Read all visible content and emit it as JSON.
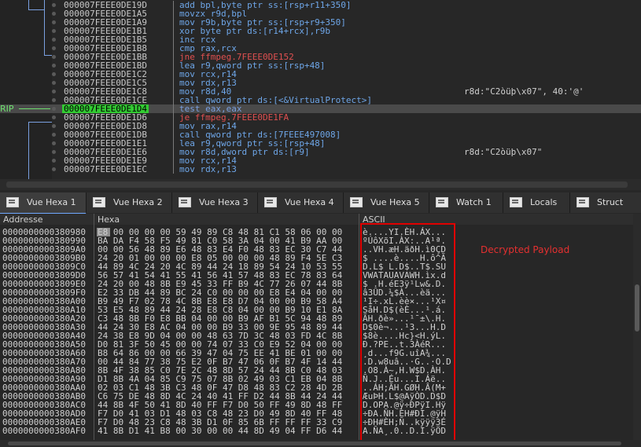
{
  "disasm": {
    "rip_label": "RIP",
    "rows": [
      {
        "addr": "000007FEEE0DE19D",
        "instr": "add bpl,byte ptr ss:[rsp+r11+350]",
        "comment": ""
      },
      {
        "addr": "000007FEEE0DE1A5",
        "instr": "movzx r9d,bpl",
        "comment": ""
      },
      {
        "addr": "000007FEEE0DE1A9",
        "instr": "mov r9b,byte ptr ss:[rsp+r9+350]",
        "comment": ""
      },
      {
        "addr": "000007FEEE0DE1B1",
        "instr": "xor byte ptr ds:[r14+rcx],r9b",
        "comment": ""
      },
      {
        "addr": "000007FEEE0DE1B5",
        "instr": "inc rcx",
        "comment": ""
      },
      {
        "addr": "000007FEEE0DE1B8",
        "instr": "cmp rax,rcx",
        "comment": ""
      },
      {
        "addr": "000007FEEE0DE1BB",
        "instr": "jne ffmpeg.7FEEE0DE152",
        "comment": ""
      },
      {
        "addr": "000007FEEE0DE1BD",
        "instr": "lea r9,qword ptr ss:[rsp+48]",
        "comment": ""
      },
      {
        "addr": "000007FEEE0DE1C2",
        "instr": "mov rcx,r14",
        "comment": ""
      },
      {
        "addr": "000007FEEE0DE1C5",
        "instr": "mov rdx,r13",
        "comment": ""
      },
      {
        "addr": "000007FEEE0DE1C8",
        "instr": "mov r8d,40",
        "comment": "r8d:\"C2òüþ\\x07\", 40:'@'"
      },
      {
        "addr": "000007FEEE0DE1CE",
        "instr": "call qword ptr ds:[<&VirtualProtect>]",
        "comment": ""
      },
      {
        "addr": "000007FEEE0DE1D4",
        "instr": "test eax,eax",
        "comment": ""
      },
      {
        "addr": "000007FEEE0DE1D6",
        "instr": "je ffmpeg.7FEEE0DE1FA",
        "comment": ""
      },
      {
        "addr": "000007FEEE0DE1D8",
        "instr": "mov rax,r14",
        "comment": ""
      },
      {
        "addr": "000007FEEE0DE1DB",
        "instr": "call qword ptr ds:[7FEEE497008]",
        "comment": ""
      },
      {
        "addr": "000007FEEE0DE1E1",
        "instr": "lea r9,qword ptr ss:[rsp+48]",
        "comment": ""
      },
      {
        "addr": "000007FEEE0DE1E6",
        "instr": "mov r8d,dword ptr ds:[r9]",
        "comment": "r8d:\"C2òüþ\\x07\""
      },
      {
        "addr": "000007FEEE0DE1E9",
        "instr": "mov rcx,r14",
        "comment": ""
      },
      {
        "addr": "000007FEEE0DE1EC",
        "instr": "mov rdx,r13",
        "comment": ""
      }
    ]
  },
  "tabs": [
    {
      "label": "Vue Hexa 1",
      "icon": "dump-icon"
    },
    {
      "label": "Vue Hexa 2",
      "icon": "dump-icon"
    },
    {
      "label": "Vue Hexa 3",
      "icon": "dump-icon"
    },
    {
      "label": "Vue Hexa 4",
      "icon": "dump-icon"
    },
    {
      "label": "Vue Hexa 5",
      "icon": "dump-icon"
    },
    {
      "label": "Watch 1",
      "icon": "watch-icon"
    },
    {
      "label": "Locals",
      "icon": "locals-icon"
    },
    {
      "label": "Struct",
      "icon": "struct-icon"
    }
  ],
  "hexview": {
    "col_address": "Addresse",
    "col_hex": "Hexa",
    "col_ascii": "ASCII",
    "rows": [
      {
        "addr": "0000000000380980",
        "hex": "E8 00 00 00 00 59 49 89 C8 48 81 C1 58 06 00 00",
        "ascii": "è....YI.ÈH.ÁX..."
      },
      {
        "addr": "0000000000380990",
        "hex": "BA DA F4 58 F5 49 81 C0 58 3A 04 00 41 B9 AA 00",
        "ascii": "ºÚôXõI.ÀX:..A¹ª."
      },
      {
        "addr": "00000000003809A0",
        "hex": "00 00 56 48 89 E6 48 83 E4 F0 48 83 EC 30 C7 44",
        "ascii": "..VH.æH.äðH.ì0ÇD"
      },
      {
        "addr": "00000000003809B0",
        "hex": "24 20 01 00 00 00 E8 05 00 00 00 48 89 F4 5E C3",
        "ascii": "$ ....è....H.ô^Ã"
      },
      {
        "addr": "00000000003809C0",
        "hex": "44 89 4C 24 20 4C 89 44 24 18 89 54 24 10 53 55",
        "ascii": "D.L$ L.D$..T$.SU"
      },
      {
        "addr": "00000000003809D0",
        "hex": "56 57 41 54 41 55 41 56 41 57 48 83 EC 78 83 64",
        "ascii": "VWATAUAVAWH.ìx.d"
      },
      {
        "addr": "00000000003809E0",
        "hex": "24 20 00 48 8B E9 45 33 FF B9 4C 77 26 07 44 8B",
        "ascii": "$ .H.éE3ÿ¹Lw&.D."
      },
      {
        "addr": "00000000003809F0",
        "hex": "E2 33 DB 44 89 BC 24 C0 00 00 00 E8 E4 04 00 00",
        "ascii": "â3ÛD.¼$À...èä..."
      },
      {
        "addr": "0000000000380A00",
        "hex": "B9 49 F7 02 78 4C 8B E8 E8 D7 04 00 00 B9 58 A4",
        "ascii": "¹I÷.xL.èè×...¹X¤"
      },
      {
        "addr": "0000000000380A10",
        "hex": "53 E5 48 89 44 24 28 E8 C8 04 00 00 B9 10 E1 8A",
        "ascii": "SåH.D$(èÈ...¹.á."
      },
      {
        "addr": "0000000000380A20",
        "hex": "C3 48 8B F0 E8 BB 04 00 00 B9 AF B1 5C 94 48 89",
        "ascii": "ÃH.ðè»...¹¯±\\.H."
      },
      {
        "addr": "0000000000380A30",
        "hex": "44 24 30 E8 AC 04 00 00 B9 33 00 9E 95 48 89 44",
        "ascii": "D$0è¬...¹3...H.D"
      },
      {
        "addr": "0000000000380A40",
        "hex": "24 38 E8 9D 04 00 00 48 63 7D 3C 48 03 FD 4C 8B",
        "ascii": "$8è....Hc}<H.ýL."
      },
      {
        "addr": "0000000000380A50",
        "hex": "D0 81 3F 50 45 00 00 74 07 33 C0 E9 52 04 00 00",
        "ascii": "Ð.?PE..t.3ÀéR..."
      },
      {
        "addr": "0000000000380A60",
        "hex": "B8 64 86 00 00 66 39 47 04 75 EE 41 BE 01 00 00",
        "ascii": "¸d...f9G.uîA¾..."
      },
      {
        "addr": "0000000000380A70",
        "hex": "00 44 84 77 38 75 E2 0F B7 47 06 0F B7 4F 14 44",
        "ascii": ".D.w8uâ..·G..·O.D"
      },
      {
        "addr": "0000000000380A80",
        "hex": "8B 4F 38 85 C0 7E 2C 48 8D 57 24 44 8B C0 48 03",
        "ascii": ".O8.À~,H.W$D.ÀH."
      },
      {
        "addr": "0000000000380A90",
        "hex": "D1 8B 4A 04 85 C9 75 07 8B 02 49 03 C1 EB 04 8B",
        "ascii": "Ñ.J..Éu...I.Áë.."
      },
      {
        "addr": "0000000000380AA0",
        "hex": "02 03 C1 48 3B C3 48 0F 47 D8 48 83 C2 28 4D 2B",
        "ascii": "..ÁH;ÃH.GØH.Â(M+"
      },
      {
        "addr": "0000000000380AB0",
        "hex": "C6 75 DE 48 8D 4C 24 40 41 FF D2 44 8B 44 24 44",
        "ascii": "ÆuÞH.L$@AÿÒD.D$D"
      },
      {
        "addr": "0000000000380AC0",
        "hex": "44 8B 4F 50 41 8D 40 FF F7 D0 50 FF 49 8D 48 FF",
        "ascii": "D.OPA.@ÿ÷ÐPÿI.Hÿ"
      },
      {
        "addr": "0000000000380AD0",
        "hex": "F7 D0 41 03 D1 48 03 C8 48 23 D0 49 8D 40 FF 48",
        "ascii": "÷ÐA.ÑH.ÈH#ÐI.@ÿH"
      },
      {
        "addr": "0000000000380AE0",
        "hex": "F7 D0 48 23 C8 48 3B D1 0F 85 6B FF FF FF 33 C9",
        "ascii": "÷ÐH#ÈH;Ñ..kÿÿÿ3É"
      },
      {
        "addr": "0000000000380AF0",
        "hex": "41 8B D1 41 B8 00 30 00 00 44 8D 49 04 FF D6 44",
        "ascii": "A.ÑA¸.0..D.I.ÿÖD"
      }
    ]
  },
  "annotation": {
    "label": "Decrypted Payload",
    "color": "#e00000"
  }
}
